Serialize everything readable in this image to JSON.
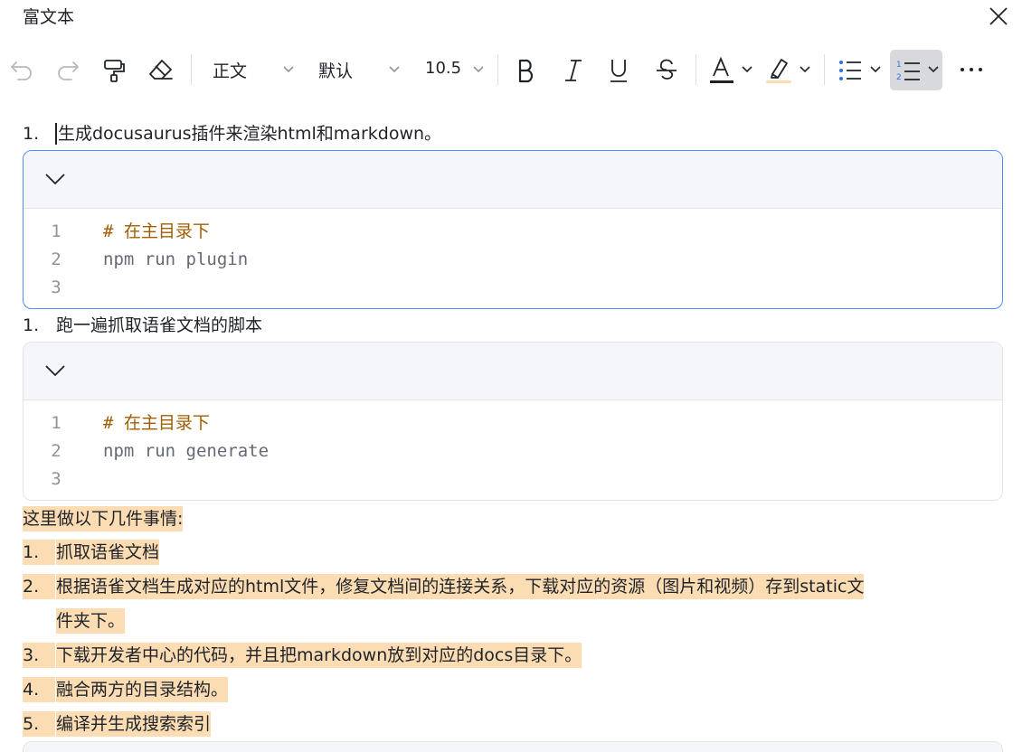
{
  "window": {
    "title": "富文本"
  },
  "toolbar": {
    "style_value": "正文",
    "font_value": "默认",
    "size_value": "10.5"
  },
  "document": {
    "item1": {
      "number": "1.",
      "text": "生成docusaurus插件来渲染html和markdown。"
    },
    "code1": {
      "lines": [
        {
          "no": "1",
          "text": "# 在主目录下"
        },
        {
          "no": "2",
          "text": "npm run plugin"
        },
        {
          "no": "3",
          "text": ""
        }
      ]
    },
    "item2": {
      "number": "1.",
      "text": "跑一遍抓取语雀文档的脚本"
    },
    "code2": {
      "lines": [
        {
          "no": "1",
          "text": "# 在主目录下"
        },
        {
          "no": "2",
          "text": "npm run generate"
        },
        {
          "no": "3",
          "text": ""
        }
      ]
    },
    "intro": "这里做以下几件事情:",
    "steps": [
      {
        "number": "1.",
        "text": "抓取语雀文档"
      },
      {
        "number": "2.",
        "text": "根据语雀文档生成对应的html文件，修复文档间的连接关系，下载对应的资源（图片和视频）存到static文",
        "cont": "件夹下。"
      },
      {
        "number": "3.",
        "text": "下载开发者中心的代码，并且把markdown放到对应的docs目录下。"
      },
      {
        "number": "4.",
        "text": "融合两方的目录结构。"
      },
      {
        "number": "5.",
        "text": "编译并生成搜索索引"
      }
    ]
  },
  "colors": {
    "highlight": "#fbdcb3",
    "comment": "#a15c00",
    "active_border": "#4a8ef0",
    "toolbar_bg": "#f5f6f7"
  }
}
